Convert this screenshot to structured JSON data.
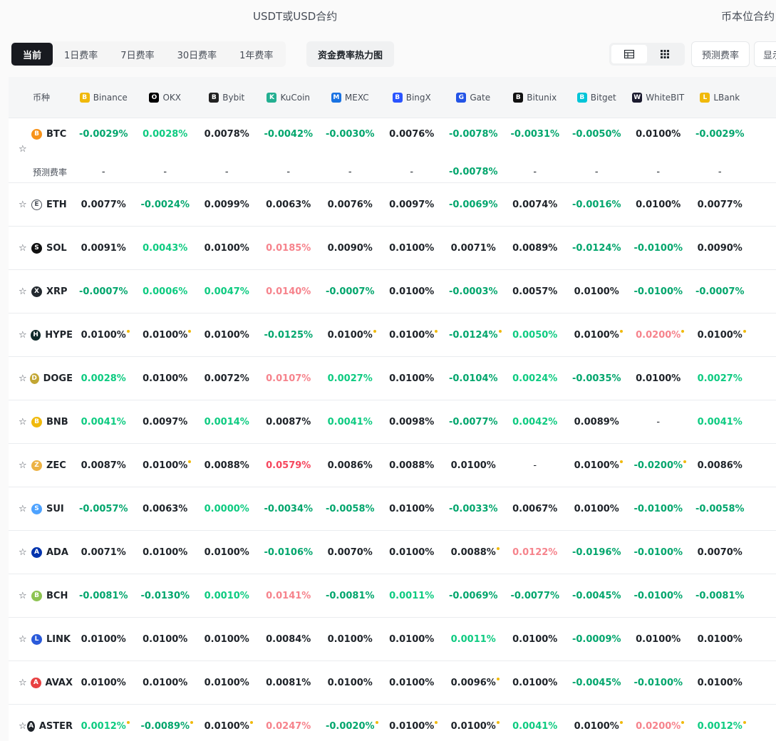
{
  "header": {
    "usdt_title": "USDT或USD合约",
    "coin_title": "币本位合约"
  },
  "tabs": [
    "当前",
    "1日费率",
    "7日费率",
    "30日费率",
    "1年费率"
  ],
  "heatmap_label": "资金费率热力图",
  "predict_label": "预测费率",
  "display_label": "显示",
  "table": {
    "coin_header": "币种",
    "exchanges": [
      {
        "name": "Binance",
        "icon": "binance-icon",
        "color": "#f0b90b"
      },
      {
        "name": "OKX",
        "icon": "okx-icon",
        "color": "#000000"
      },
      {
        "name": "Bybit",
        "icon": "bybit-icon",
        "color": "#222222"
      },
      {
        "name": "KuCoin",
        "icon": "kucoin-icon",
        "color": "#23af91"
      },
      {
        "name": "MEXC",
        "icon": "mexc-icon",
        "color": "#1972e2"
      },
      {
        "name": "BingX",
        "icon": "bingx-icon",
        "color": "#2a54ff"
      },
      {
        "name": "Gate",
        "icon": "gate-icon",
        "color": "#2354e6"
      },
      {
        "name": "Bitunix",
        "icon": "bitunix-icon",
        "color": "#111111"
      },
      {
        "name": "Bitget",
        "icon": "bitget-icon",
        "color": "#00c5d8"
      },
      {
        "name": "WhiteBIT",
        "icon": "whitebit-icon",
        "color": "#1b1b2f"
      },
      {
        "name": "LBank",
        "icon": "lbank-icon",
        "color": "#f0b90b"
      }
    ],
    "predict_row_label": "预测费率",
    "btc_predicted": [
      "-",
      "-",
      "-",
      "-",
      "-",
      "-",
      "-0.0078%",
      "-",
      "-",
      "-",
      "-"
    ],
    "rows": [
      {
        "coin": "BTC",
        "logo_color": "#f7931a",
        "values": [
          {
            "v": "-0.0029%",
            "c": "neg"
          },
          {
            "v": "0.0028%",
            "c": "pos"
          },
          {
            "v": "0.0078%",
            "c": "neu"
          },
          {
            "v": "-0.0042%",
            "c": "neg"
          },
          {
            "v": "-0.0030%",
            "c": "neg"
          },
          {
            "v": "0.0076%",
            "c": "neu"
          },
          {
            "v": "-0.0078%",
            "c": "neg"
          },
          {
            "v": "-0.0031%",
            "c": "neg"
          },
          {
            "v": "-0.0050%",
            "c": "neg"
          },
          {
            "v": "0.0100%",
            "c": "neu"
          },
          {
            "v": "-0.0029%",
            "c": "neg"
          }
        ]
      },
      {
        "coin": "ETH",
        "logo_color": "#ffffff",
        "values": [
          {
            "v": "0.0077%",
            "c": "neu"
          },
          {
            "v": "-0.0024%",
            "c": "neg"
          },
          {
            "v": "0.0099%",
            "c": "neu"
          },
          {
            "v": "0.0063%",
            "c": "neu"
          },
          {
            "v": "0.0076%",
            "c": "neu"
          },
          {
            "v": "0.0097%",
            "c": "neu"
          },
          {
            "v": "-0.0069%",
            "c": "neg"
          },
          {
            "v": "0.0074%",
            "c": "neu"
          },
          {
            "v": "-0.0016%",
            "c": "neg"
          },
          {
            "v": "0.0100%",
            "c": "neu"
          },
          {
            "v": "0.0077%",
            "c": "neu"
          }
        ]
      },
      {
        "coin": "SOL",
        "logo_color": "#111111",
        "values": [
          {
            "v": "0.0091%",
            "c": "neu"
          },
          {
            "v": "0.0043%",
            "c": "pos"
          },
          {
            "v": "0.0100%",
            "c": "neu"
          },
          {
            "v": "0.0185%",
            "c": "red"
          },
          {
            "v": "0.0090%",
            "c": "neu"
          },
          {
            "v": "0.0100%",
            "c": "neu"
          },
          {
            "v": "0.0071%",
            "c": "neu"
          },
          {
            "v": "0.0089%",
            "c": "neu"
          },
          {
            "v": "-0.0124%",
            "c": "neg"
          },
          {
            "v": "-0.0100%",
            "c": "neg"
          },
          {
            "v": "0.0090%",
            "c": "neu"
          }
        ]
      },
      {
        "coin": "XRP",
        "logo_color": "#23292f",
        "values": [
          {
            "v": "-0.0007%",
            "c": "neg"
          },
          {
            "v": "0.0006%",
            "c": "pos"
          },
          {
            "v": "0.0047%",
            "c": "pos"
          },
          {
            "v": "0.0140%",
            "c": "red"
          },
          {
            "v": "-0.0007%",
            "c": "neg"
          },
          {
            "v": "0.0100%",
            "c": "neu"
          },
          {
            "v": "-0.0003%",
            "c": "neg"
          },
          {
            "v": "0.0057%",
            "c": "neu"
          },
          {
            "v": "0.0100%",
            "c": "neu"
          },
          {
            "v": "-0.0100%",
            "c": "neg"
          },
          {
            "v": "-0.0007%",
            "c": "neg"
          }
        ]
      },
      {
        "coin": "HYPE",
        "logo_color": "#0f2a2a",
        "values": [
          {
            "v": "0.0100%",
            "c": "neu",
            "d": 1
          },
          {
            "v": "0.0100%",
            "c": "neu",
            "d": 1
          },
          {
            "v": "0.0100%",
            "c": "neu"
          },
          {
            "v": "-0.0125%",
            "c": "neg"
          },
          {
            "v": "0.0100%",
            "c": "neu",
            "d": 1
          },
          {
            "v": "0.0100%",
            "c": "neu",
            "d": 1
          },
          {
            "v": "-0.0124%",
            "c": "neg",
            "d": 1
          },
          {
            "v": "0.0050%",
            "c": "pos"
          },
          {
            "v": "0.0100%",
            "c": "neu",
            "d": 1
          },
          {
            "v": "0.0200%",
            "c": "red",
            "d": 1
          },
          {
            "v": "0.0100%",
            "c": "neu",
            "d": 1
          }
        ]
      },
      {
        "coin": "DOGE",
        "logo_color": "#c2a633",
        "values": [
          {
            "v": "0.0028%",
            "c": "pos"
          },
          {
            "v": "0.0100%",
            "c": "neu"
          },
          {
            "v": "0.0072%",
            "c": "neu"
          },
          {
            "v": "0.0107%",
            "c": "red"
          },
          {
            "v": "0.0027%",
            "c": "pos"
          },
          {
            "v": "0.0100%",
            "c": "neu"
          },
          {
            "v": "-0.0104%",
            "c": "neg"
          },
          {
            "v": "0.0024%",
            "c": "pos"
          },
          {
            "v": "-0.0035%",
            "c": "neg"
          },
          {
            "v": "0.0100%",
            "c": "neu"
          },
          {
            "v": "0.0027%",
            "c": "pos"
          }
        ]
      },
      {
        "coin": "BNB",
        "logo_color": "#f0b90b",
        "values": [
          {
            "v": "0.0041%",
            "c": "pos"
          },
          {
            "v": "0.0097%",
            "c": "neu"
          },
          {
            "v": "0.0014%",
            "c": "pos"
          },
          {
            "v": "0.0087%",
            "c": "neu"
          },
          {
            "v": "0.0041%",
            "c": "pos"
          },
          {
            "v": "0.0098%",
            "c": "neu"
          },
          {
            "v": "-0.0077%",
            "c": "neg"
          },
          {
            "v": "0.0042%",
            "c": "pos"
          },
          {
            "v": "0.0089%",
            "c": "neu"
          },
          {
            "v": "-",
            "c": "neu"
          },
          {
            "v": "0.0041%",
            "c": "pos"
          }
        ]
      },
      {
        "coin": "ZEC",
        "logo_color": "#ecb244",
        "values": [
          {
            "v": "0.0087%",
            "c": "neu"
          },
          {
            "v": "0.0100%",
            "c": "neu",
            "d": 1
          },
          {
            "v": "0.0088%",
            "c": "neu"
          },
          {
            "v": "0.0579%",
            "c": "redstrong"
          },
          {
            "v": "0.0086%",
            "c": "neu"
          },
          {
            "v": "0.0088%",
            "c": "neu"
          },
          {
            "v": "0.0100%",
            "c": "neu"
          },
          {
            "v": "-",
            "c": "neu"
          },
          {
            "v": "0.0100%",
            "c": "neu",
            "d": 1
          },
          {
            "v": "-0.0200%",
            "c": "neg",
            "d": 1
          },
          {
            "v": "0.0086%",
            "c": "neu"
          }
        ]
      },
      {
        "coin": "SUI",
        "logo_color": "#4da2ff",
        "values": [
          {
            "v": "-0.0057%",
            "c": "neg"
          },
          {
            "v": "0.0063%",
            "c": "neu"
          },
          {
            "v": "0.0000%",
            "c": "pos"
          },
          {
            "v": "-0.0034%",
            "c": "neg"
          },
          {
            "v": "-0.0058%",
            "c": "neg"
          },
          {
            "v": "0.0100%",
            "c": "neu"
          },
          {
            "v": "-0.0033%",
            "c": "neg"
          },
          {
            "v": "0.0067%",
            "c": "neu"
          },
          {
            "v": "0.0100%",
            "c": "neu"
          },
          {
            "v": "-0.0100%",
            "c": "neg"
          },
          {
            "v": "-0.0058%",
            "c": "neg"
          }
        ]
      },
      {
        "coin": "ADA",
        "logo_color": "#0033ad",
        "values": [
          {
            "v": "0.0071%",
            "c": "neu"
          },
          {
            "v": "0.0100%",
            "c": "neu"
          },
          {
            "v": "0.0100%",
            "c": "neu"
          },
          {
            "v": "-0.0106%",
            "c": "neg"
          },
          {
            "v": "0.0070%",
            "c": "neu"
          },
          {
            "v": "0.0100%",
            "c": "neu"
          },
          {
            "v": "0.0088%",
            "c": "neu",
            "d": 1
          },
          {
            "v": "0.0122%",
            "c": "red"
          },
          {
            "v": "-0.0196%",
            "c": "neg"
          },
          {
            "v": "-0.0100%",
            "c": "neg"
          },
          {
            "v": "0.0070%",
            "c": "neu"
          }
        ]
      },
      {
        "coin": "BCH",
        "logo_color": "#8dc351",
        "values": [
          {
            "v": "-0.0081%",
            "c": "neg"
          },
          {
            "v": "-0.0130%",
            "c": "neg"
          },
          {
            "v": "0.0010%",
            "c": "pos"
          },
          {
            "v": "0.0141%",
            "c": "red"
          },
          {
            "v": "-0.0081%",
            "c": "neg"
          },
          {
            "v": "0.0011%",
            "c": "pos"
          },
          {
            "v": "-0.0069%",
            "c": "neg"
          },
          {
            "v": "-0.0077%",
            "c": "neg"
          },
          {
            "v": "-0.0045%",
            "c": "neg"
          },
          {
            "v": "-0.0100%",
            "c": "neg"
          },
          {
            "v": "-0.0081%",
            "c": "neg"
          }
        ]
      },
      {
        "coin": "LINK",
        "logo_color": "#2a5ada",
        "values": [
          {
            "v": "0.0100%",
            "c": "neu"
          },
          {
            "v": "0.0100%",
            "c": "neu"
          },
          {
            "v": "0.0100%",
            "c": "neu"
          },
          {
            "v": "0.0084%",
            "c": "neu"
          },
          {
            "v": "0.0100%",
            "c": "neu"
          },
          {
            "v": "0.0100%",
            "c": "neu"
          },
          {
            "v": "0.0011%",
            "c": "pos"
          },
          {
            "v": "0.0100%",
            "c": "neu"
          },
          {
            "v": "-0.0009%",
            "c": "neg"
          },
          {
            "v": "0.0100%",
            "c": "neu"
          },
          {
            "v": "0.0100%",
            "c": "neu"
          }
        ]
      },
      {
        "coin": "AVAX",
        "logo_color": "#e84142",
        "values": [
          {
            "v": "0.0100%",
            "c": "neu"
          },
          {
            "v": "0.0100%",
            "c": "neu"
          },
          {
            "v": "0.0100%",
            "c": "neu"
          },
          {
            "v": "0.0081%",
            "c": "neu"
          },
          {
            "v": "0.0100%",
            "c": "neu"
          },
          {
            "v": "0.0100%",
            "c": "neu"
          },
          {
            "v": "0.0096%",
            "c": "neu",
            "d": 1
          },
          {
            "v": "0.0100%",
            "c": "neu"
          },
          {
            "v": "-0.0045%",
            "c": "neg"
          },
          {
            "v": "-0.0100%",
            "c": "neg"
          },
          {
            "v": "0.0100%",
            "c": "neu"
          }
        ]
      },
      {
        "coin": "ASTER",
        "logo_color": "#1e2329",
        "values": [
          {
            "v": "0.0012%",
            "c": "pos",
            "d": 1
          },
          {
            "v": "-0.0089%",
            "c": "neg",
            "d": 1
          },
          {
            "v": "0.0100%",
            "c": "neu",
            "d": 1
          },
          {
            "v": "0.0247%",
            "c": "red"
          },
          {
            "v": "-0.0020%",
            "c": "neg",
            "d": 1
          },
          {
            "v": "0.0100%",
            "c": "neu",
            "d": 1
          },
          {
            "v": "0.0100%",
            "c": "neu",
            "d": 1
          },
          {
            "v": "0.0041%",
            "c": "pos"
          },
          {
            "v": "0.0100%",
            "c": "neu",
            "d": 1
          },
          {
            "v": "0.0200%",
            "c": "red",
            "d": 1
          },
          {
            "v": "0.0012%",
            "c": "pos",
            "d": 1
          }
        ]
      }
    ]
  }
}
